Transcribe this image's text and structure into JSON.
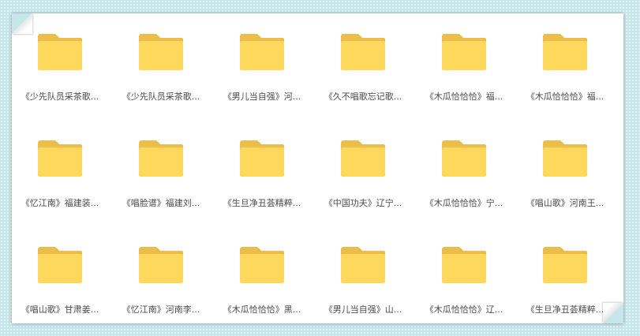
{
  "folders": [
    {
      "name": "《少先队员采茶歌..."
    },
    {
      "name": "《少先队员采茶歌..."
    },
    {
      "name": "《男儿当自强》河..."
    },
    {
      "name": "《久不唱歌忘记歌..."
    },
    {
      "name": "《木瓜恰恰恰》福..."
    },
    {
      "name": "《木瓜恰恰恰》福..."
    },
    {
      "name": "《忆江南》福建装..."
    },
    {
      "name": "《唱脸谱》福建刘..."
    },
    {
      "name": "《生旦净丑荟精粹..."
    },
    {
      "name": "《中国功夫》辽宁..."
    },
    {
      "name": "《木瓜恰恰恰》宁..."
    },
    {
      "name": "《唱山歌》河南王..."
    },
    {
      "name": "《唱山歌》甘肃姜..."
    },
    {
      "name": "《忆江南》河南李..."
    },
    {
      "name": "《木瓜恰恰恰》黑..."
    },
    {
      "name": "《男儿当自强》山..."
    },
    {
      "name": "《木瓜恰恰恰》辽..."
    },
    {
      "name": "《生旦净丑荟精粹..."
    }
  ],
  "colors": {
    "folder_front": "#fed75d",
    "folder_back": "#ecbd4a",
    "label_text": "#4a4a4a",
    "backdrop": "#c7e6ea"
  },
  "icons": {
    "folder": "folder-icon"
  }
}
